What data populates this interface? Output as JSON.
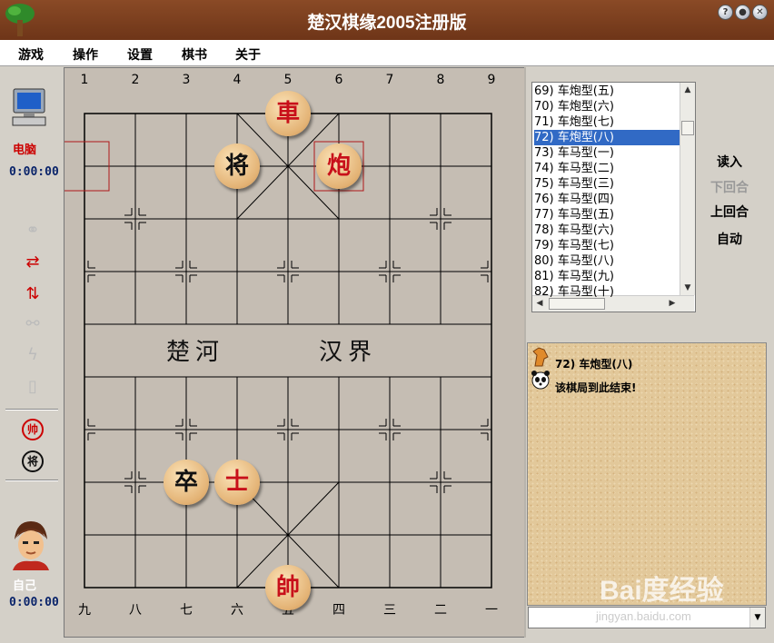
{
  "window": {
    "title": "楚汉棋缘2005注册版",
    "help": "?",
    "minimize": "●",
    "close": "✕"
  },
  "menu": [
    "游戏",
    "操作",
    "设置",
    "棋书",
    "关于"
  ],
  "left_panel": {
    "computer_label": "电脑",
    "computer_time": "0:00:00",
    "self_label": "自己",
    "self_time": "0:00:00",
    "tool_red_label": "帅",
    "tool_black_label": "将"
  },
  "board": {
    "top_numbers": [
      "1",
      "2",
      "3",
      "4",
      "5",
      "6",
      "7",
      "8",
      "9"
    ],
    "bottom_numbers": [
      "九",
      "八",
      "七",
      "六",
      "五",
      "四",
      "三",
      "二",
      "一"
    ],
    "river_left": "楚河",
    "river_right": "汉界",
    "pieces": [
      {
        "char": "車",
        "color": "red",
        "file": 4,
        "rank": 0
      },
      {
        "char": "将",
        "color": "black",
        "file": 3,
        "rank": 1
      },
      {
        "char": "炮",
        "color": "red",
        "file": 5,
        "rank": 1
      },
      {
        "char": "卒",
        "color": "black",
        "file": 2,
        "rank": 7
      },
      {
        "char": "士",
        "color": "red",
        "file": 3,
        "rank": 7
      },
      {
        "char": "帥",
        "color": "red",
        "file": 4,
        "rank": 9
      }
    ]
  },
  "list": {
    "items": [
      "69) 车炮型(五)",
      "70) 车炮型(六)",
      "71) 车炮型(七)",
      "72) 车炮型(八)",
      "73) 车马型(一)",
      "74) 车马型(二)",
      "75) 车马型(三)",
      "76) 车马型(四)",
      "77) 车马型(五)",
      "78) 车马型(六)",
      "79) 车马型(七)",
      "80) 车马型(八)",
      "81) 车马型(九)",
      "82) 车马型(十)"
    ],
    "selected_index": 3
  },
  "buttons": {
    "load": "读入",
    "next": "下回合",
    "prev": "上回合",
    "auto": "自动"
  },
  "chat": {
    "line1": "72) 车炮型(八)",
    "line2": "该棋局到此结束!"
  },
  "watermark": {
    "main": "Bai度经验",
    "sub": "jingyan.baidu.com"
  },
  "colors": {
    "titlebar": "#7a3d1e",
    "selection": "#316ac5",
    "board": "#c5bdb3",
    "red_piece_text": "#c8101a"
  }
}
